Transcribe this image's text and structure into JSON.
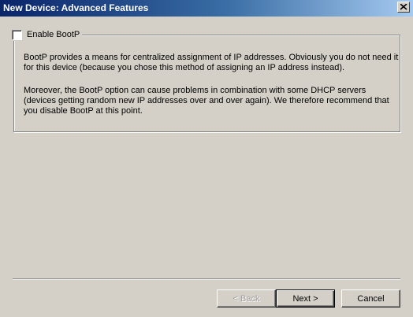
{
  "window": {
    "title": "New Device: Advanced Features",
    "close_glyph": "x"
  },
  "bootp": {
    "checkbox_label": "Enable BootP",
    "checked": false,
    "paragraph1": "BootP provides a means for centralized assignment of IP addresses. Obviously you do not need it for this device (because you chose this method of assigning an IP address instead).",
    "paragraph2": "Moreover, the BootP option can cause problems in combination with some DHCP servers (devices getting random new IP addresses over and over again). We therefore recommend that you disable BootP at this point."
  },
  "buttons": {
    "back": "< Back",
    "next": "Next >",
    "cancel": "Cancel"
  },
  "icons": {
    "close": "close-icon"
  },
  "colors": {
    "title_gradient_start": "#0a246a",
    "title_gradient_end": "#a6caf0",
    "dialog_bg": "#d4d0c8"
  }
}
